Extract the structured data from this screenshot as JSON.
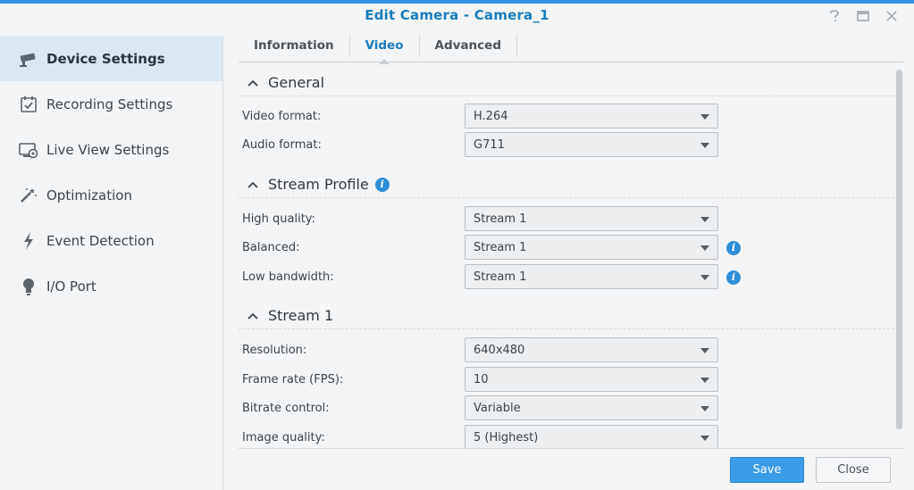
{
  "window": {
    "title": "Edit Camera - Camera_1",
    "buttons": [
      "help-icon",
      "maximize-icon",
      "close-icon"
    ]
  },
  "sidebar": {
    "items": [
      {
        "label": "Device Settings",
        "icon": "camera-icon",
        "active": true
      },
      {
        "label": "Recording Settings",
        "icon": "calendar-check-icon",
        "active": false
      },
      {
        "label": "Live View Settings",
        "icon": "monitor-camera-icon",
        "active": false
      },
      {
        "label": "Optimization",
        "icon": "magic-wand-icon",
        "active": false
      },
      {
        "label": "Event Detection",
        "icon": "lightning-icon",
        "active": false
      },
      {
        "label": "I/O Port",
        "icon": "lightbulb-icon",
        "active": false
      }
    ]
  },
  "tabs": [
    {
      "label": "Information",
      "active": false
    },
    {
      "label": "Video",
      "active": true
    },
    {
      "label": "Advanced",
      "active": false
    }
  ],
  "sections": {
    "general": {
      "title": "General",
      "rows": [
        {
          "label": "Video format:",
          "value": "H.264"
        },
        {
          "label": "Audio format:",
          "value": "G711"
        }
      ]
    },
    "stream_profile": {
      "title": "Stream Profile",
      "rows": [
        {
          "label": "High quality:",
          "value": "Stream 1"
        },
        {
          "label": "Balanced:",
          "value": "Stream 1"
        },
        {
          "label": "Low bandwidth:",
          "value": "Stream 1"
        }
      ]
    },
    "stream1": {
      "title": "Stream 1",
      "rows": [
        {
          "label": "Resolution:",
          "value": "640x480"
        },
        {
          "label": "Frame rate (FPS):",
          "value": "10"
        },
        {
          "label": "Bitrate control:",
          "value": "Variable"
        },
        {
          "label": "Image quality:",
          "value": "5 (Highest)"
        }
      ]
    }
  },
  "footer": {
    "save_label": "Save",
    "close_label": "Close"
  },
  "colors": {
    "accent": "#1b7bbd",
    "top_bar": "#2f95e3",
    "save_button": "#3a9be6",
    "active_sidebar": "#d9e8f3",
    "info_icon": "#2f8fd8"
  }
}
